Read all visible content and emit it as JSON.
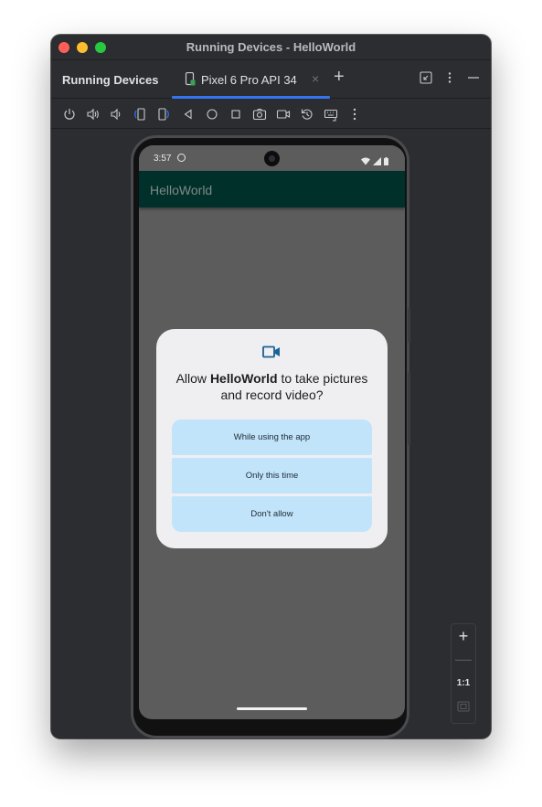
{
  "window": {
    "title": "Running Devices - HelloWorld"
  },
  "tabbar": {
    "panel_title": "Running Devices",
    "device_tab": {
      "label": "Pixel 6 Pro API 34",
      "close": "×",
      "icon": "phone-device-icon"
    },
    "add_tab": "+",
    "right_icons": [
      "collapse-icon",
      "more-vertical-icon",
      "minimize-icon"
    ]
  },
  "toolbar": {
    "icons": [
      "power-icon",
      "volume-up-icon",
      "volume-down-icon",
      "rotate-left-icon",
      "rotate-right-icon",
      "back-icon",
      "home-icon",
      "overview-icon",
      "screenshot-icon",
      "screen-record-icon",
      "reset-icon",
      "keyboard-icon",
      "more-vertical-icon"
    ]
  },
  "phone": {
    "status_time": "3:57",
    "app_title": "HelloWorld",
    "dialog": {
      "icon": "video-camera-icon",
      "title_prefix": "Allow ",
      "title_app": "HelloWorld",
      "title_suffix": " to take pictures and record video?",
      "buttons": [
        "While using the app",
        "Only this time",
        "Don't allow"
      ]
    }
  },
  "zoom": {
    "zoom_in": "+",
    "zoom_out": "—",
    "actual_size": "1:1",
    "fit_icon": "fit-screen-icon"
  },
  "colors": {
    "ide_background": "#2b2d30",
    "accent": "#3574f0",
    "app_bar": "#00302a",
    "dialog_button": "#c2e4fb",
    "dialog_icon": "#1a6196"
  }
}
